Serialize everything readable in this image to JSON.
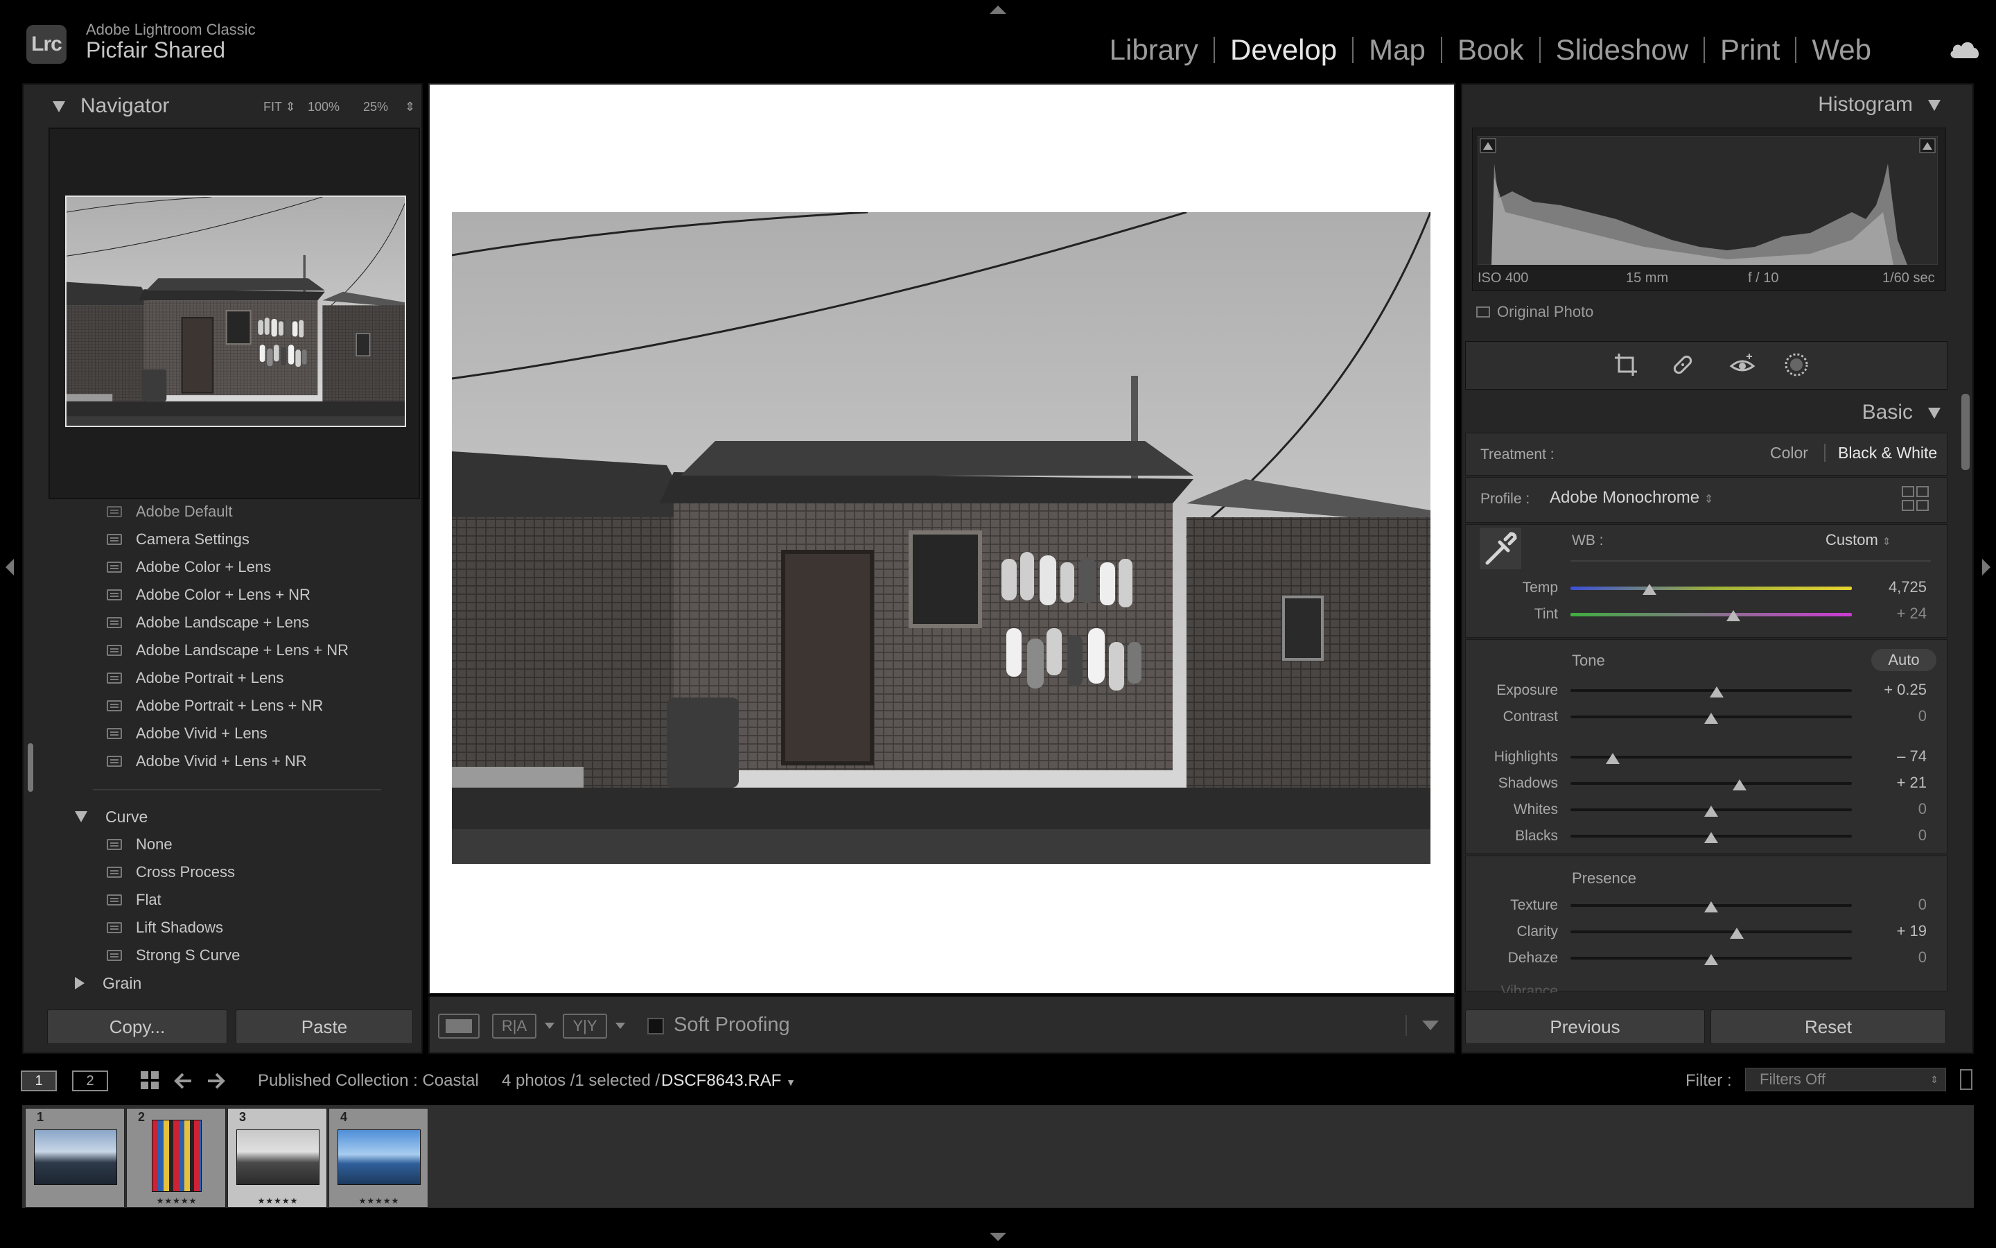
{
  "app": {
    "name": "Adobe Lightroom Classic",
    "logo": "Lrc",
    "catalog": "Picfair Shared"
  },
  "modules": [
    "Library",
    "Develop",
    "Map",
    "Book",
    "Slideshow",
    "Print",
    "Web"
  ],
  "active_module": "Develop",
  "navigator": {
    "title": "Navigator",
    "zoom_options": [
      "FIT",
      "100%",
      "25%"
    ]
  },
  "presets": {
    "items_top": [
      "Adobe Default",
      "Camera Settings",
      "Adobe Color + Lens",
      "Adobe Color + Lens + NR",
      "Adobe Landscape + Lens",
      "Adobe Landscape + Lens + NR",
      "Adobe Portrait + Lens",
      "Adobe Portrait + Lens + NR",
      "Adobe Vivid + Lens",
      "Adobe Vivid + Lens + NR"
    ],
    "curve_group": "Curve",
    "curve_items": [
      "None",
      "Cross Process",
      "Flat",
      "Lift Shadows",
      "Strong S Curve"
    ],
    "grain_group": "Grain"
  },
  "left_buttons": {
    "copy": "Copy...",
    "paste": "Paste"
  },
  "toolbar": {
    "ra": "R|A",
    "yy": "Y|Y",
    "soft_proofing": "Soft Proofing"
  },
  "histogram": {
    "title": "Histogram",
    "iso": "ISO 400",
    "focal": "15 mm",
    "aperture": "f / 10",
    "shutter": "1/60 sec",
    "original_photo": "Original Photo"
  },
  "basic": {
    "title": "Basic",
    "treatment_label": "Treatment :",
    "treatment_options": [
      "Color",
      "Black & White"
    ],
    "treatment_selected": "Black & White",
    "profile_label": "Profile :",
    "profile_value": "Adobe Monochrome",
    "wb_label": "WB :",
    "wb_value": "Custom",
    "temp": {
      "label": "Temp",
      "value": "4,725",
      "position": 0.28
    },
    "tint": {
      "label": "Tint",
      "value": "+ 24",
      "position": 0.58
    },
    "tone_label": "Tone",
    "auto_label": "Auto",
    "tone": [
      {
        "label": "Exposure",
        "value": "+ 0.25",
        "position": 0.52
      },
      {
        "label": "Contrast",
        "value": "0",
        "position": 0.5
      },
      {
        "label": "Highlights",
        "value": "– 74",
        "position": 0.15
      },
      {
        "label": "Shadows",
        "value": "+ 21",
        "position": 0.6
      },
      {
        "label": "Whites",
        "value": "0",
        "position": 0.5
      },
      {
        "label": "Blacks",
        "value": "0",
        "position": 0.5
      }
    ],
    "presence_label": "Presence",
    "presence": [
      {
        "label": "Texture",
        "value": "0",
        "position": 0.5
      },
      {
        "label": "Clarity",
        "value": "+ 19",
        "position": 0.59
      },
      {
        "label": "Dehaze",
        "value": "0",
        "position": 0.5
      }
    ],
    "partial_label": "Vibrance"
  },
  "right_buttons": {
    "previous": "Previous",
    "reset": "Reset"
  },
  "filmstrip": {
    "screens": [
      "1",
      "2"
    ],
    "collection": "Published Collection : Coastal",
    "count_text": "4 photos /1 selected /",
    "filename": "DSCF8643.RAF",
    "filter_label": "Filter :",
    "filter_value": "Filters Off",
    "cells": [
      {
        "num": "1",
        "stars": ""
      },
      {
        "num": "2",
        "stars": "★★★★★"
      },
      {
        "num": "3",
        "stars": "★★★★★"
      },
      {
        "num": "4",
        "stars": "★★★★★"
      }
    ]
  },
  "colors": {
    "accent": "#e6e6e6",
    "panel": "#262626",
    "background": "#000000"
  }
}
